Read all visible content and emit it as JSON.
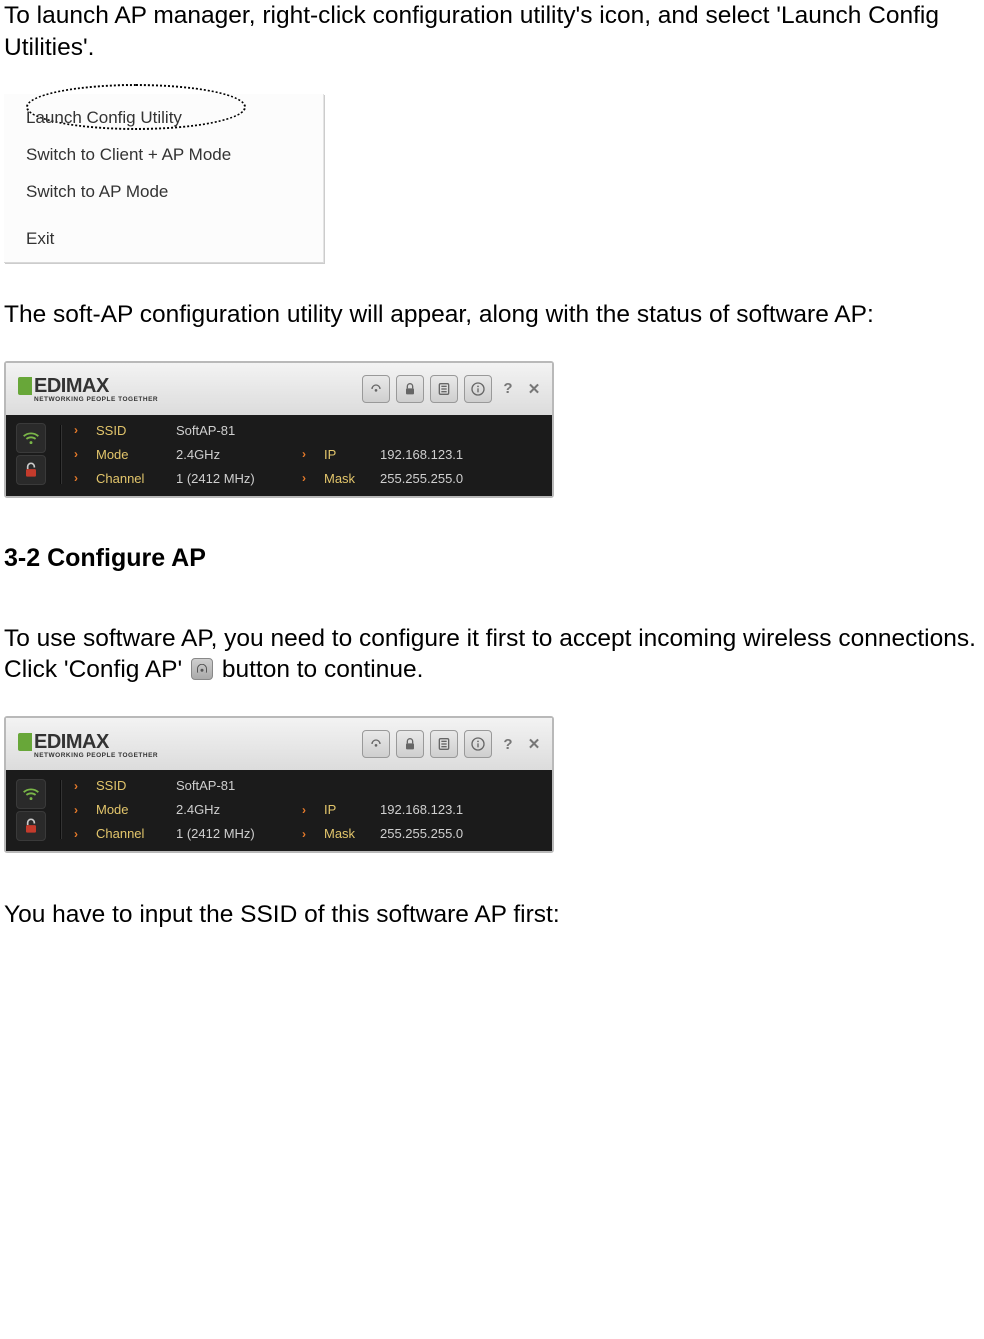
{
  "para1": "To launch AP manager, right-click configuration utility's icon, and select 'Launch Config Utilities'.",
  "menu": {
    "launch": "Launch Config Utility",
    "clientap": "Switch to Client + AP Mode",
    "apmode": "Switch to AP Mode",
    "exit": "Exit"
  },
  "para2": "The soft-AP configuration utility will appear, along with the status of software AP:",
  "heading": "3-2 Configure AP",
  "para3a": "To use software AP, you need to configure it first to accept incoming wireless connections. Click 'Config AP' ",
  "para3b": " button to continue.",
  "para4": "You have to input the SSID of this software AP first:",
  "logo": {
    "brand": "EDIMAX",
    "tagline": "NETWORKING PEOPLE TOGETHER"
  },
  "panel": {
    "ssid_label": "SSID",
    "ssid_value": "SoftAP-81",
    "mode_label": "Mode",
    "mode_value": "2.4GHz",
    "channel_label": "Channel",
    "channel_value": "1 (2412 MHz)",
    "ip_label": "IP",
    "ip_value": "192.168.123.1",
    "mask_label": "Mask",
    "mask_value": "255.255.255.0"
  }
}
